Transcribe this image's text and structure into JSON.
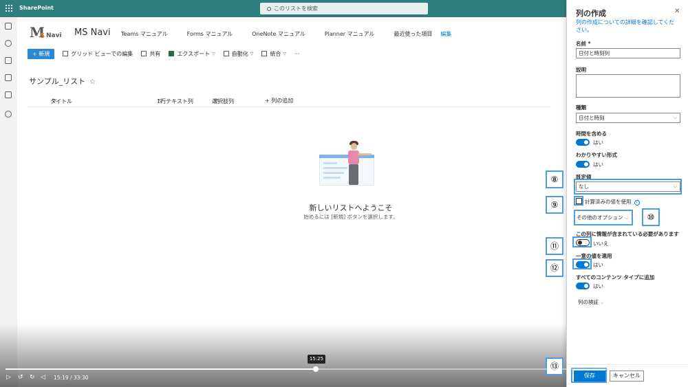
{
  "topbar": {
    "app_name": "SharePoint",
    "search_placeholder": "このリストを検索"
  },
  "site": {
    "logo_letter": "M",
    "logo_s": "S",
    "logo_navi": "Navi",
    "name": "MS Navi",
    "nav": [
      "Teams マニュアル",
      "Forms マニュアル",
      "OneNote マニュアル",
      "Planner マニュアル",
      "最近使った項目"
    ],
    "nav_edit": "編集"
  },
  "commandbar": {
    "new": "+ 新規",
    "grid_edit": "グリッド ビューでの編集",
    "share": "共有",
    "export": "エクスポート",
    "automate": "自動化",
    "integrate": "統合",
    "more": "···"
  },
  "list": {
    "title": "サンプル_リスト",
    "star": "☆",
    "columns": [
      "タイトル",
      "1行テキスト列",
      "選択肢列",
      "+ 列の追加"
    ],
    "empty_title": "新しいリストへようこそ",
    "empty_sub": "始めるには [新規] ボタンを選択します。"
  },
  "panel": {
    "title": "列の作成",
    "close": "✕",
    "details_link": "列の作成についての詳細を確認してください。",
    "name_label": "名前 *",
    "name_value": "日付と時刻列",
    "desc_label": "説明",
    "type_label": "種類",
    "type_value": "日付と時刻",
    "include_time_label": "時間を含める",
    "include_time_value": "はい",
    "friendly_label": "わかりやすい形式",
    "friendly_value": "はい",
    "default_label": "既定値",
    "default_value": "なし",
    "calc_label": "計算済みの値を使用",
    "more_options": "その他のオプション",
    "required_label": "この列に情報が含まれている必要があります",
    "required_value": "いいえ",
    "unique_label": "一意の値を適用",
    "unique_value": "はい",
    "all_ct_label": "すべてのコンテンツ タイプに追加",
    "all_ct_value": "はい",
    "validation": "列の検証",
    "save": "保存",
    "cancel": "キャンセル"
  },
  "callouts": [
    "⑧",
    "⑨",
    "⑩",
    "⑪",
    "⑫",
    "⑬"
  ],
  "video": {
    "tooltip": "15:25",
    "time": "15:19 / 33:30",
    "progress": 0.458
  }
}
